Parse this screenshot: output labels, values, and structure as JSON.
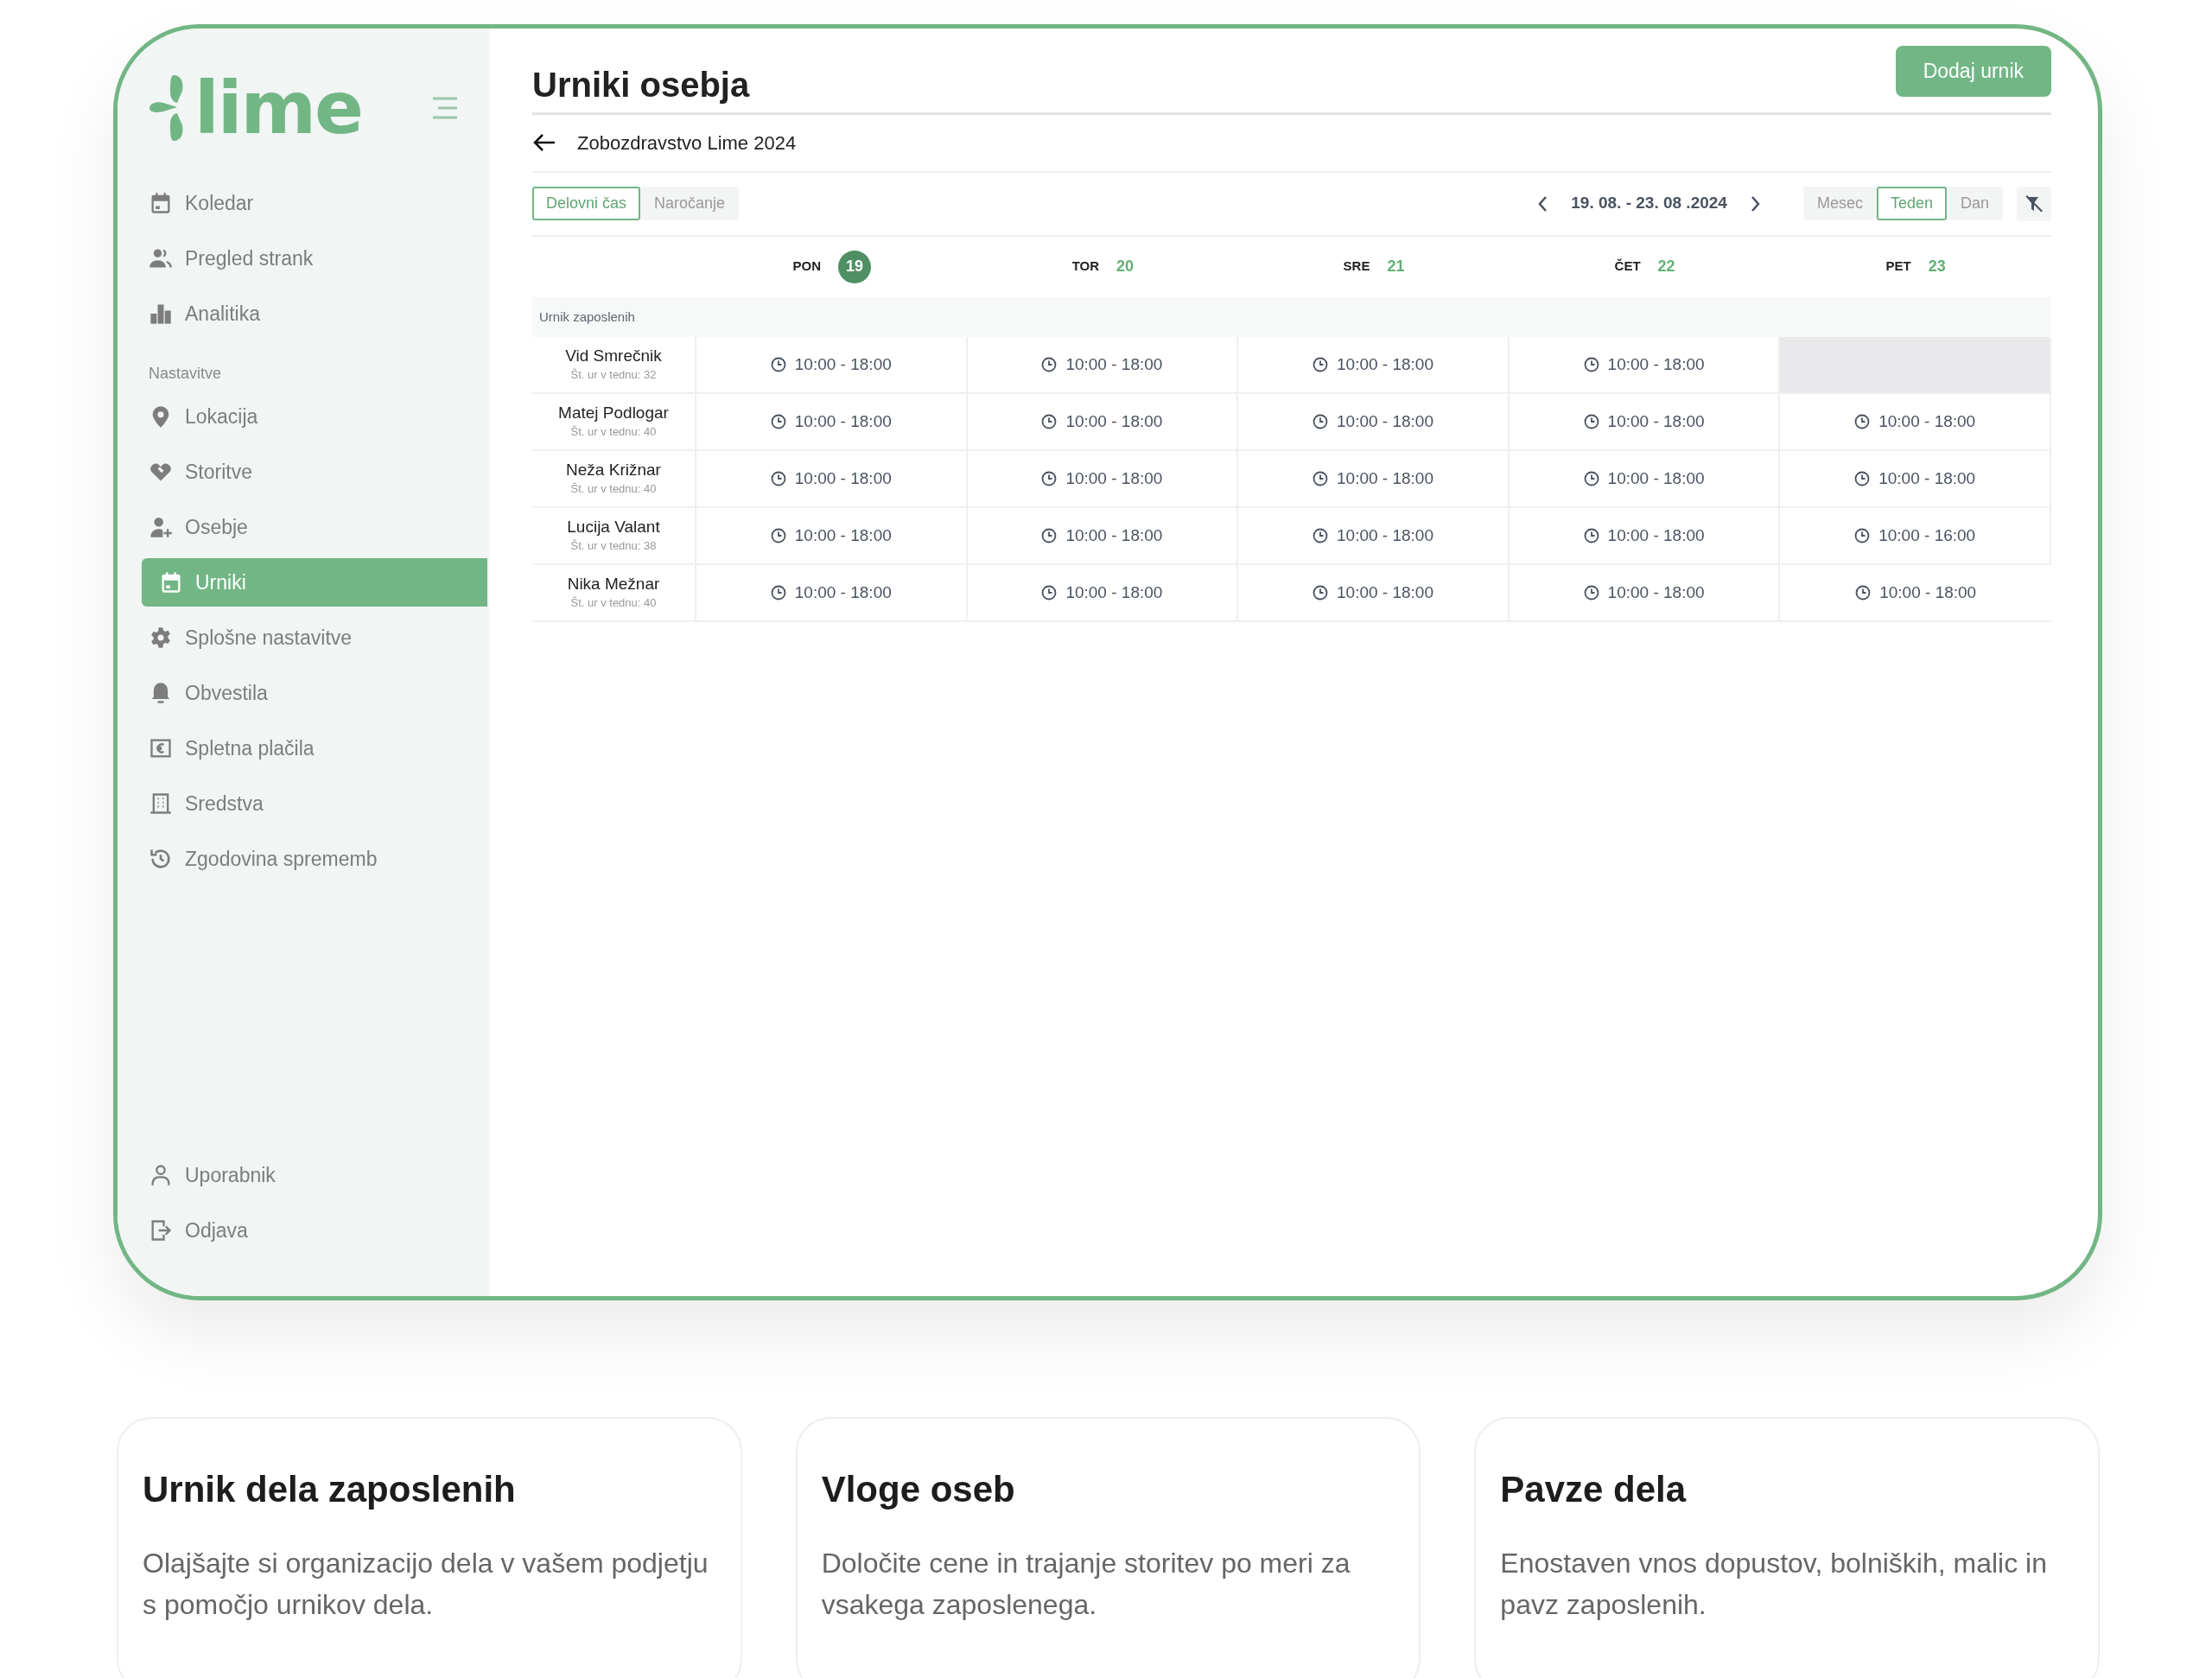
{
  "sidebar": {
    "logo": "lime",
    "nav_items": [
      {
        "label": "Koledar",
        "selected": false
      },
      {
        "label": "Pregled strank",
        "selected": false
      },
      {
        "label": "Analitika",
        "selected": false
      }
    ],
    "settings_heading": "Nastavitve",
    "settings_items": [
      {
        "label": "Lokacija",
        "selected": false
      },
      {
        "label": "Storitve",
        "selected": false
      },
      {
        "label": "Osebje",
        "selected": false
      },
      {
        "label": "Urniki",
        "selected": true
      },
      {
        "label": "Splošne nastavitve",
        "selected": false
      },
      {
        "label": "Obvestila",
        "selected": false
      },
      {
        "label": "Spletna plačila",
        "selected": false
      },
      {
        "label": "Sredstva",
        "selected": false
      },
      {
        "label": "Zgodovina sprememb",
        "selected": false
      }
    ],
    "account_items": [
      {
        "label": "Uporabnik",
        "selected": false
      },
      {
        "label": "Odjava",
        "selected": false
      }
    ]
  },
  "header": {
    "title": "Urniki osebja",
    "add_button": "Dodaj urnik",
    "subtitle": "Zobozdravstvo Lime 2024"
  },
  "mode_tabs": [
    {
      "label": "Delovni čas",
      "selected": true
    },
    {
      "label": "Naročanje",
      "selected": false
    }
  ],
  "date_range": "19. 08. - 23. 08 .2024",
  "view_tabs": [
    {
      "label": "Mesec",
      "selected": false
    },
    {
      "label": "Teden",
      "selected": true
    },
    {
      "label": "Dan",
      "selected": false
    }
  ],
  "days": [
    {
      "name": "PON",
      "date": "19",
      "selected": true
    },
    {
      "name": "TOR",
      "date": "20",
      "selected": false
    },
    {
      "name": "SRE",
      "date": "21",
      "selected": false
    },
    {
      "name": "ČET",
      "date": "22",
      "selected": false
    },
    {
      "name": "PET",
      "date": "23",
      "selected": false
    }
  ],
  "group_label": "Urnik zaposlenih",
  "rows": [
    {
      "name": "Vid Smrečnik",
      "hours": "Št. ur v tednu: 32",
      "cells": [
        {
          "kind": "shift",
          "time": "10:00 - 18:00"
        },
        {
          "kind": "shift",
          "time": "10:00 - 18:00"
        },
        {
          "kind": "shift",
          "time": "10:00 - 18:00"
        },
        {
          "kind": "shift",
          "time": "10:00 - 18:00"
        },
        {
          "kind": "off"
        }
      ]
    },
    {
      "name": "Matej Podlogar",
      "hours": "Št. ur v tednu: 40",
      "cells": [
        {
          "kind": "shift",
          "time": "10:00 - 18:00"
        },
        {
          "kind": "shift",
          "time": "10:00 - 18:00"
        },
        {
          "kind": "shift",
          "time": "10:00 - 18:00"
        },
        {
          "kind": "shift",
          "time": "10:00 - 18:00"
        },
        {
          "kind": "shift",
          "time": "10:00 - 18:00"
        }
      ]
    },
    {
      "name": "Neža Križnar",
      "hours": "Št. ur v tednu: 40",
      "cells": [
        {
          "kind": "shift",
          "time": "10:00 - 18:00"
        },
        {
          "kind": "shift",
          "time": "10:00 - 18:00"
        },
        {
          "kind": "shift",
          "time": "10:00 - 18:00"
        },
        {
          "kind": "shift",
          "time": "10:00 - 18:00"
        },
        {
          "kind": "shift",
          "time": "10:00 - 18:00"
        }
      ]
    },
    {
      "name": "Lucija Valant",
      "hours": "Št. ur v tednu: 38",
      "cells": [
        {
          "kind": "shift",
          "time": "10:00 - 18:00"
        },
        {
          "kind": "shift",
          "time": "10:00 - 18:00"
        },
        {
          "kind": "shift",
          "time": "10:00 - 18:00"
        },
        {
          "kind": "shift",
          "time": "10:00 - 18:00"
        },
        {
          "kind": "shift",
          "time": "10:00 - 16:00"
        }
      ]
    },
    {
      "name": "Nika Mežnar",
      "hours": "Št. ur v tednu: 40",
      "cells": [
        {
          "kind": "shift",
          "time": "10:00 - 18:00"
        },
        {
          "kind": "shift",
          "time": "10:00 - 18:00"
        },
        {
          "kind": "shift",
          "time": "10:00 - 18:00"
        },
        {
          "kind": "shift",
          "time": "10:00 - 18:00"
        },
        {
          "kind": "shift",
          "time": "10:00 - 18:00"
        }
      ]
    }
  ],
  "features": [
    {
      "title": "Urnik dela zaposlenih",
      "text": "Olajšajte si organizacijo dela v vašem podjetju s pomočjo urnikov dela."
    },
    {
      "title": "Vloge oseb",
      "text": "Določite cene in trajanje storitev po meri za vsakega zaposlenega."
    },
    {
      "title": "Pavze dela",
      "text": "Enostaven vnos dopustov, bolniških, malic in pavz zaposlenih."
    }
  ]
}
